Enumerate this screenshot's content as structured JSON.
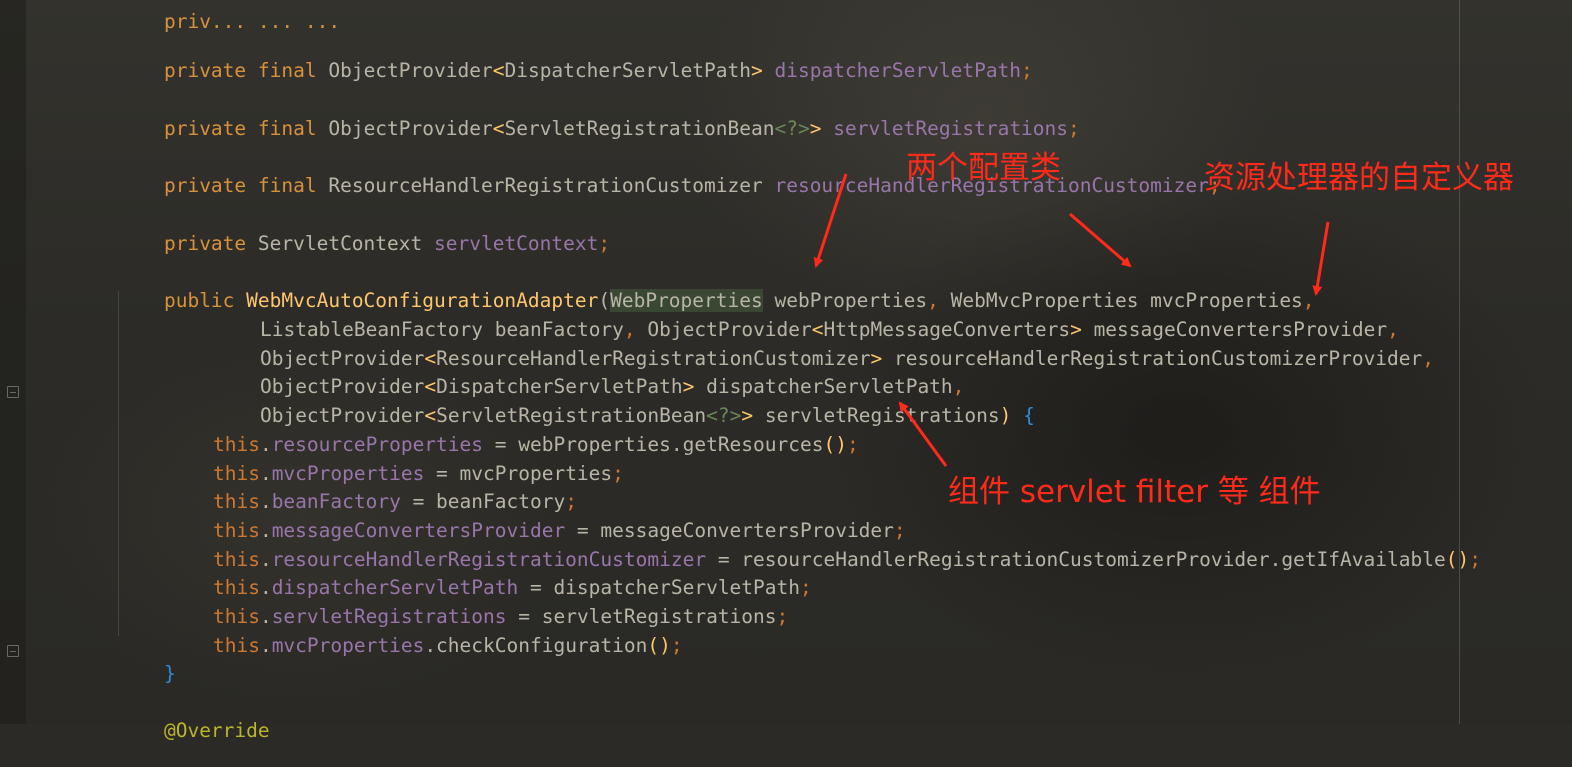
{
  "code": {
    "line_top_partial": "priv... ... ...",
    "decl_dispatcher": {
      "mods": "private final ",
      "type": "ObjectProvider",
      "lt": "<",
      "generic": "DispatcherServletPath",
      "gt": "> ",
      "field": "dispatcherServletPath",
      "semi": ";"
    },
    "decl_servletRegs": {
      "mods": "private final ",
      "type": "ObjectProvider",
      "lt": "<",
      "generic": "ServletRegistrationBean",
      "wild": "<?>",
      "gt": "> ",
      "field": "servletRegistrations",
      "semi": ";"
    },
    "decl_customizer": {
      "mods": "private final ",
      "type": "ResourceHandlerRegistrationCustomizer ",
      "field": "resourceHandlerRegistrationCustomizer",
      "semi": ";"
    },
    "decl_servletContext": {
      "mods": "private ",
      "type": "ServletContext ",
      "field": "servletContext",
      "semi": ";"
    },
    "ctor": {
      "mods": "public ",
      "name": "WebMvcAutoConfigurationAdapter",
      "open": "(",
      "p1_type": "WebProperties",
      "p1_name": " webProperties",
      "comma": ", ",
      "p2": "WebMvcProperties mvcProperties",
      "line2_a": "ListableBeanFactory beanFactory",
      "line2_b": "ObjectProvider",
      "line2_c": "HttpMessageConverters",
      "line2_d": "messageConvertersProvider",
      "line3_a": "ObjectProvider",
      "line3_b": "ResourceHandlerRegistrationCustomizer",
      "line3_c": "resourceHandlerRegistrationCustomizerProvider",
      "line4_a": "ObjectProvider",
      "line4_b": "DispatcherServletPath",
      "line4_c": "dispatcherServletPath",
      "line5_a": "ObjectProvider",
      "line5_b": "ServletRegistrationBean",
      "line5_c": "servletRegistrations",
      "close": ") ",
      "brace_open": "{",
      "brace_close": "}"
    },
    "body": [
      {
        "self": "this",
        "dot": ".",
        "field": "resourceProperties",
        "rhs": " = webProperties.getResources",
        "call": "()",
        "semi": ";"
      },
      {
        "self": "this",
        "dot": ".",
        "field": "mvcProperties",
        "rhs": " = mvcProperties",
        "call": "",
        "semi": ";"
      },
      {
        "self": "this",
        "dot": ".",
        "field": "beanFactory",
        "rhs": " = beanFactory",
        "call": "",
        "semi": ";"
      },
      {
        "self": "this",
        "dot": ".",
        "field": "messageConvertersProvider",
        "rhs": " = messageConvertersProvider",
        "call": "",
        "semi": ";"
      },
      {
        "self": "this",
        "dot": ".",
        "field": "resourceHandlerRegistrationCustomizer",
        "rhs": " = resourceHandlerRegistrationCustomizerProvider.getIfAvailable",
        "call": "()",
        "semi": ";"
      },
      {
        "self": "this",
        "dot": ".",
        "field": "dispatcherServletPath",
        "rhs": " = dispatcherServletPath",
        "call": "",
        "semi": ";"
      },
      {
        "self": "this",
        "dot": ".",
        "field": "servletRegistrations",
        "rhs": " = servletRegistrations",
        "call": "",
        "semi": ";"
      },
      {
        "self": "this",
        "dot": ".",
        "field": "mvcProperties",
        "rhs": ".checkConfiguration",
        "call": "()",
        "semi": ";"
      }
    ],
    "annotation": "@Override"
  },
  "annotations": {
    "two_config_classes": "两个配置类",
    "resource_handler_customizer": "资源处理器的自定义器",
    "components": "组件 servlet filter 等 组件",
    "color": "#ff2a1a"
  }
}
